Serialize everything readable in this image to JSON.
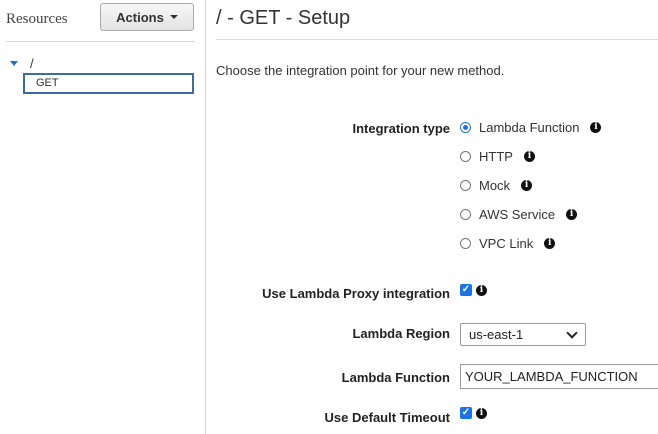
{
  "sidebar": {
    "title": "Resources",
    "actions_label": "Actions",
    "tree_root": "/",
    "tree_selected": "GET"
  },
  "main": {
    "title": "/ - GET - Setup",
    "description": "Choose the integration point for your new method.",
    "integration_type_label": "Integration type",
    "integration_options": [
      {
        "label": "Lambda Function",
        "selected": true
      },
      {
        "label": "HTTP",
        "selected": false
      },
      {
        "label": "Mock",
        "selected": false
      },
      {
        "label": "AWS Service",
        "selected": false
      },
      {
        "label": "VPC Link",
        "selected": false
      }
    ],
    "proxy_label": "Use Lambda Proxy integration",
    "proxy_checked": true,
    "region_label": "Lambda Region",
    "region_value": "us-east-1",
    "function_label": "Lambda Function",
    "function_value": "YOUR_LAMBDA_FUNCTION",
    "timeout_label": "Use Default Timeout",
    "timeout_checked": true
  },
  "icons": {
    "info": "info-icon",
    "check": "checkmark"
  },
  "colors": {
    "accent": "#1a73e8",
    "selected_border": "#3a6aa8"
  }
}
